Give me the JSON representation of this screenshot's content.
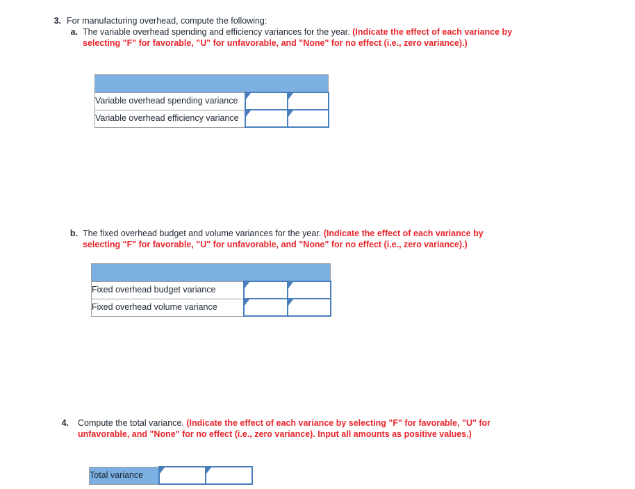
{
  "questions": [
    {
      "number": "3.",
      "text_plain": "For manufacturing overhead, compute the following:",
      "text_red": ""
    },
    {
      "number": "a.",
      "text_plain": "The variable overhead spending and efficiency variances for the year. ",
      "text_red": "(Indicate the effect of each variance by selecting \"F\" for favorable, \"U\" for unfavorable, and \"None\" for no effect (i.e., zero variance).)"
    },
    {
      "number": "b.",
      "text_plain": "The fixed overhead budget and volume variances for the year. ",
      "text_red": "(Indicate the effect of each variance by selecting \"F\" for favorable, \"U\" for unfavorable, and \"None\" for no effect (i.e., zero variance).)"
    },
    {
      "number": "4.",
      "text_plain": "Compute the total variance. ",
      "text_red": "(Indicate the effect of each variance by selecting \"F\" for favorable, \"U\" for unfavorable, and \"None\" for no effect (i.e., zero variance). Input all amounts as positive values.)"
    }
  ],
  "tables": {
    "variable_overhead": {
      "header_label": "",
      "rows": [
        {
          "label": "Variable overhead spending variance",
          "amount": "",
          "effect": ""
        },
        {
          "label": "Variable overhead efficiency variance",
          "amount": "",
          "effect": ""
        }
      ]
    },
    "fixed_overhead": {
      "header_label": "",
      "rows": [
        {
          "label": "Fixed overhead budget variance",
          "amount": "",
          "effect": ""
        },
        {
          "label": "Fixed overhead volume variance",
          "amount": "",
          "effect": ""
        }
      ]
    },
    "total_variance": {
      "rows": [
        {
          "label": "Total variance",
          "amount": "",
          "effect": ""
        }
      ]
    }
  },
  "colors": {
    "header_blue": "#7cb0e3",
    "input_border_blue": "#4a7ebb",
    "instruction_red": "#e8252d",
    "text_dark": "#1d2733",
    "cell_border_gray": "#9d9d9d"
  },
  "inputs": {
    "placeholder": ""
  }
}
